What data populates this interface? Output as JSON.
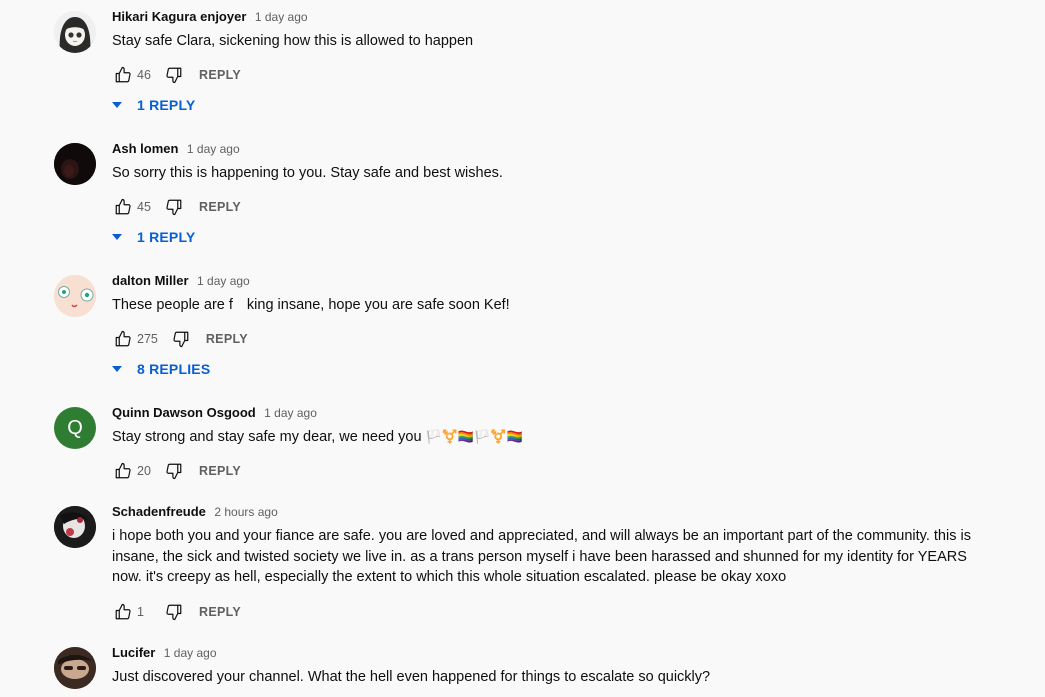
{
  "comments": [
    {
      "author": "Hikari Kagura enjoyer",
      "time": "1 day ago",
      "text": "Stay safe Clara, sickening how this is allowed to happen",
      "likes": "46",
      "reply_label": "REPLY",
      "replies_label": "1 REPLY",
      "avatar_icon": "anime-girl-avatar"
    },
    {
      "author": "Ash lomen",
      "time": "1 day ago",
      "text": "So sorry this is happening to you. Stay safe and best wishes.",
      "likes": "45",
      "reply_label": "REPLY",
      "replies_label": "1 REPLY",
      "avatar_icon": "dark-photo-avatar"
    },
    {
      "author": "dalton Miller",
      "time": "1 day ago",
      "text_before": "These people are f",
      "text_after": "king insane, hope you are safe soon Kef!",
      "likes": "275",
      "reply_label": "REPLY",
      "replies_label": "8 REPLIES",
      "avatar_icon": "cartoon-face-avatar"
    },
    {
      "author": "Quinn Dawson Osgood",
      "time": "1 day ago",
      "text": "Stay strong and stay safe my dear, we need you",
      "emoji_text": "🏳️⚧️🏳️‍🌈🏳️⚧️🏳️‍🌈",
      "likes": "20",
      "reply_label": "REPLY",
      "avatar_letter": "Q",
      "avatar_color": "#2e7d32"
    },
    {
      "author": "Schadenfreude",
      "time": "2 hours ago",
      "text": "i hope both you and your fiance are safe. you are loved and appreciated, and will always be an important part of the community. this is insane, the sick and twisted society we live in. as a trans person myself i have been harassed and shunned for my identity for YEARS now. it's creepy as hell, especially the extent to which this whole situation escalated. please be okay xoxo",
      "likes": "1",
      "reply_label": "REPLY",
      "avatar_icon": "photo-avatar"
    },
    {
      "author": "Lucifer",
      "time": "1 day ago",
      "text": "Just discovered your channel. What the hell even happened for things to escalate so quickly?",
      "avatar_icon": "photo-avatar"
    }
  ],
  "colors": {
    "link_blue": "#065fd4",
    "secondary_text": "#606060",
    "background": "#f9f9f9"
  }
}
